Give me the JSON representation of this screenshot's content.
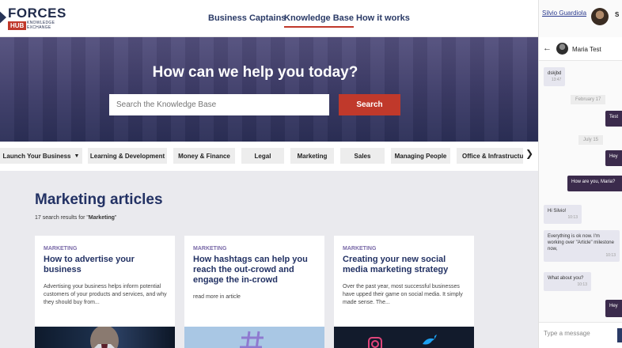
{
  "brand": {
    "name": "FORCES",
    "hub": "HUB",
    "knowledge": "KNOWLEDGE",
    "exchange": "EXCHANGE"
  },
  "nav": {
    "items": [
      "Business Captains",
      "Knowledge Base",
      "How it works"
    ],
    "active": "Knowledge Base"
  },
  "hero": {
    "title": "How can we help you today?",
    "search_placeholder": "Search the Knowledge Base",
    "search_button": "Search"
  },
  "categories": [
    "Launch Your Business",
    "Learning & Development",
    "Money & Finance",
    "Legal",
    "Marketing",
    "Sales",
    "Managing People",
    "Office & Infrastructure"
  ],
  "main": {
    "title": "Marketing articles",
    "results_prefix": "17 search results for \"",
    "results_query": "Marketing",
    "results_suffix": "\""
  },
  "articles": [
    {
      "tag": "MARKETING",
      "title": "How to advertise your business",
      "excerpt": "Advertising your business helps inform potential customers of your products and services, and why they should buy from..."
    },
    {
      "tag": "MARKETING",
      "title": "How hashtags can help you reach the out-crowd and engage the in-crowd",
      "excerpt": "read more in article"
    },
    {
      "tag": "MARKETING",
      "title": "Creating your new social media marketing strategy",
      "excerpt": "Over the past year, most successful businesses have upped their game on social media. It simply made sense. The..."
    }
  ],
  "chat": {
    "user": "Silvio Guardiola",
    "user_short": "S",
    "contact": "Maria Test",
    "input_placeholder": "Type a message",
    "messages": [
      {
        "kind": "in",
        "text": "dskjbd",
        "time": "13:47"
      },
      {
        "kind": "date",
        "text": "February 17"
      },
      {
        "kind": "out",
        "text": "Test",
        "time": ""
      },
      {
        "kind": "date",
        "text": "July 15"
      },
      {
        "kind": "out",
        "text": "Hey",
        "time": ""
      },
      {
        "kind": "out",
        "text": "How are you, Maria?",
        "time": ""
      },
      {
        "kind": "in",
        "text": "Hi Silvio!",
        "time": "10:13"
      },
      {
        "kind": "in",
        "text": "Everything is ok now. I'm working over \"Article\" milestone now,",
        "time": "10:13"
      },
      {
        "kind": "in",
        "text": "What about you?",
        "time": "10:13"
      },
      {
        "kind": "out",
        "text": "Hey",
        "time": ""
      }
    ]
  },
  "colors": {
    "navy": "#233264",
    "accent": "#c0392b",
    "chat_out": "#3b2b4c",
    "chat_in": "#e6e6ef"
  }
}
